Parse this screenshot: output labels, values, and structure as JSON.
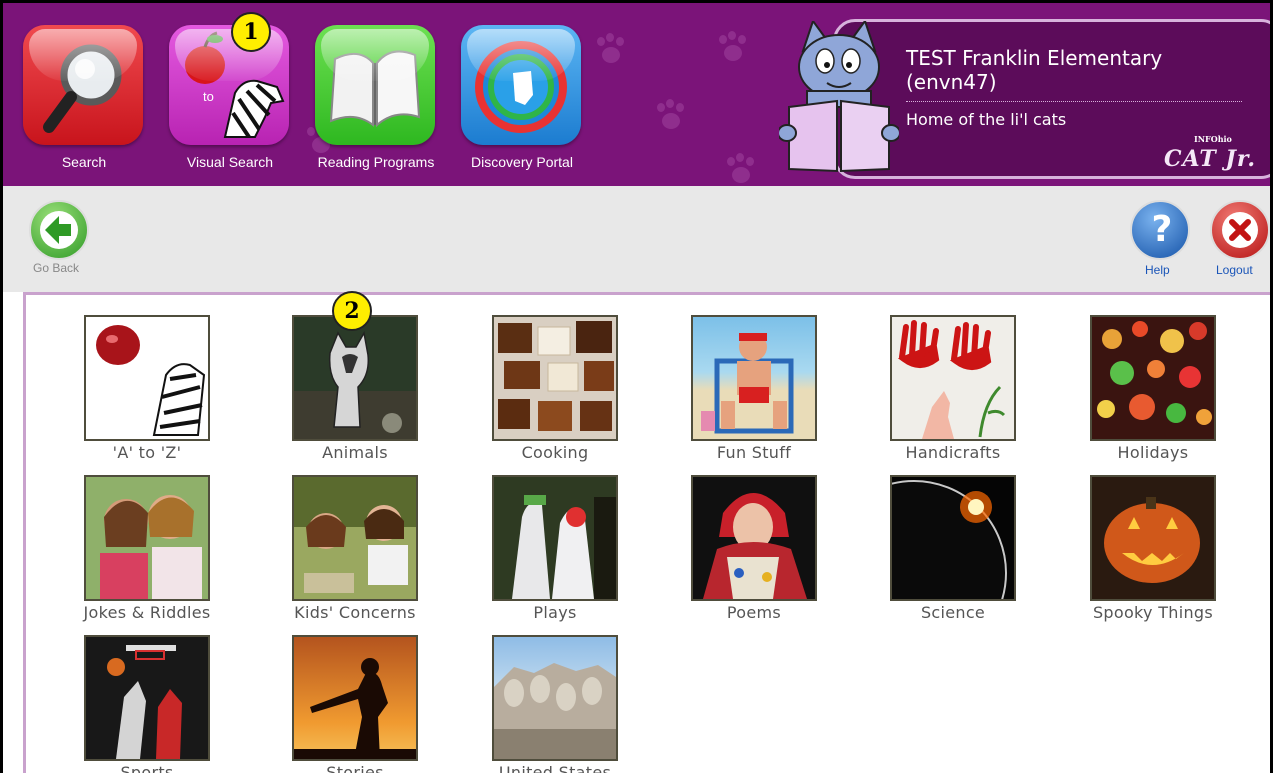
{
  "nav": {
    "buttons": [
      {
        "label": "Search"
      },
      {
        "label": "Visual Search",
        "tile_text": "to"
      },
      {
        "label": "Reading Programs"
      },
      {
        "label": "Discovery Portal"
      }
    ]
  },
  "callouts": {
    "first": "1",
    "second": "2"
  },
  "account": {
    "school": "TEST Franklin Elementary",
    "code": "(envn47)",
    "tagline": "Home of the li'l cats",
    "logo_small": "INFOhio",
    "logo": "CAT Jr."
  },
  "toolbar": {
    "go_back": "Go Back",
    "help": "Help",
    "logout": "Logout"
  },
  "categories": [
    {
      "label": "'A' to 'Z'"
    },
    {
      "label": "Animals"
    },
    {
      "label": "Cooking"
    },
    {
      "label": "Fun Stuff"
    },
    {
      "label": "Handicrafts"
    },
    {
      "label": "Holidays"
    },
    {
      "label": "Jokes & Riddles"
    },
    {
      "label": "Kids' Concerns"
    },
    {
      "label": "Plays"
    },
    {
      "label": "Poems"
    },
    {
      "label": "Science"
    },
    {
      "label": "Spooky Things"
    },
    {
      "label": "Sports"
    },
    {
      "label": "Stories"
    },
    {
      "label": "United States"
    }
  ],
  "colors": {
    "header_purple": "#7b1479",
    "panel_purple": "#5c0c5a",
    "search_red": "#e0222a",
    "visual_magenta": "#d93fd0",
    "reading_green": "#3ccd2c",
    "discovery_blue": "#2f97e6",
    "badge_yellow": "#ffee00"
  },
  "icons": [
    "magnifier-icon",
    "apple-zebra-icon",
    "open-book-icon",
    "ohio-globe-icon",
    "back-arrow-icon",
    "help-icon",
    "logout-icon"
  ]
}
